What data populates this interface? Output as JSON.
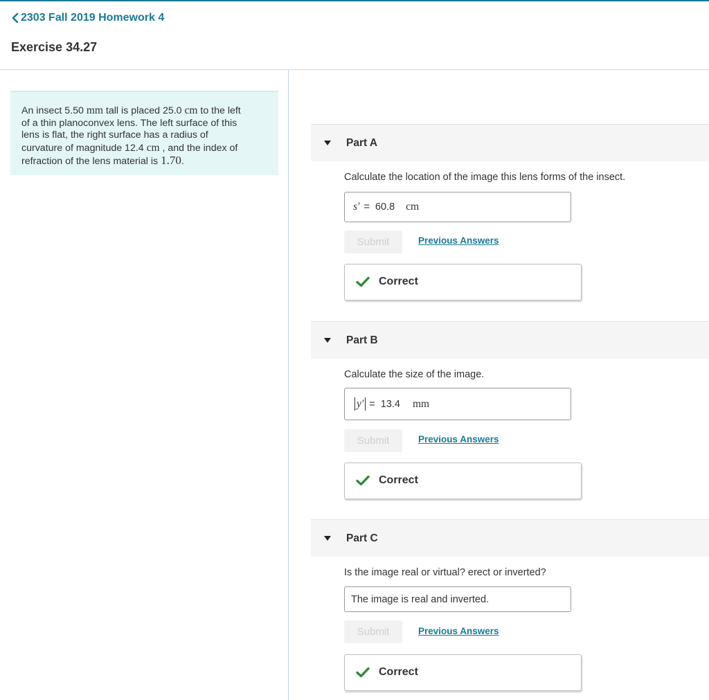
{
  "header": {
    "breadcrumb": "2303 Fall 2019 Homework 4",
    "title": "Exercise 34.27"
  },
  "problem": {
    "line1_a": "An insect 5.50 ",
    "line1_b": "mm",
    "line1_c": " tall is placed 25.0 ",
    "line1_d": "cm",
    "line1_e": " to the left",
    "line2": "of a thin planoconvex lens. The left surface of this",
    "line3": "lens is flat, the right surface has a radius of",
    "line4_a": "curvature of magnitude 12.4 ",
    "line4_b": "cm",
    "line4_c": " , and the index of",
    "line5_a": "refraction of the lens material is ",
    "line5_b": "1.70",
    "line5_c": "."
  },
  "parts": [
    {
      "label": "Part A",
      "question": "Calculate the location of the image this lens forms of the insect.",
      "variable": "s′",
      "equals": "=",
      "value": "60.8",
      "unit": "cm",
      "submit_label": "Submit",
      "previous_answers_label": "Previous Answers",
      "feedback": "Correct"
    },
    {
      "label": "Part B",
      "question": "Calculate the size of the image.",
      "variable": "y′",
      "equals": "=",
      "value": "13.4",
      "unit": "mm",
      "submit_label": "Submit",
      "previous_answers_label": "Previous Answers",
      "feedback": "Correct"
    },
    {
      "label": "Part C",
      "question": "Is the image real or virtual? erect or inverted?",
      "answer_prefix": "The image is ",
      "answer_value": "real and inverted",
      "answer_suffix": " .",
      "submit_label": "Submit",
      "previous_answers_label": "Previous Answers",
      "feedback": "Correct"
    }
  ],
  "colors": {
    "link": "#1a7a96",
    "problem_bg": "#e5f6f7",
    "correct_check": "#2e8b3a"
  },
  "icons": {
    "back": "chevron-left-icon",
    "collapse": "triangle-down-icon",
    "correct": "checkmark-icon"
  }
}
